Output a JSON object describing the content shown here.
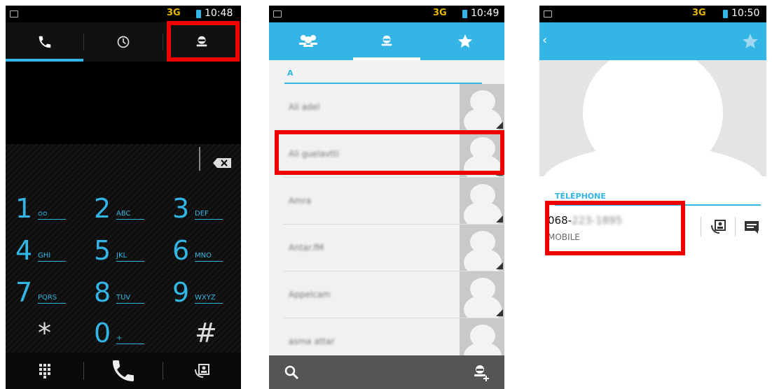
{
  "status_bars": [
    {
      "network": "3G",
      "time": "10:48"
    },
    {
      "network": "3G",
      "time": "10:49"
    },
    {
      "network": "3G",
      "time": "10:50"
    }
  ],
  "dialer": {
    "tabs": [
      "phone-icon",
      "clock-icon",
      "contact-icon"
    ],
    "selected_tab": 0,
    "keys": [
      {
        "digit": "1",
        "letters": "ᴑᴑ"
      },
      {
        "digit": "2",
        "letters": "ABC"
      },
      {
        "digit": "3",
        "letters": "DEF"
      },
      {
        "digit": "4",
        "letters": "GHI"
      },
      {
        "digit": "5",
        "letters": "JKL"
      },
      {
        "digit": "6",
        "letters": "MNO"
      },
      {
        "digit": "7",
        "letters": "PQRS"
      },
      {
        "digit": "8",
        "letters": "TUV"
      },
      {
        "digit": "9",
        "letters": "WXYZ"
      },
      {
        "digit": "*",
        "letters": ""
      },
      {
        "digit": "0",
        "letters": "+"
      },
      {
        "digit": "#",
        "letters": ""
      }
    ]
  },
  "contacts": {
    "tabs": [
      "groups-icon",
      "contact-icon",
      "star-icon"
    ],
    "selected_tab": 1,
    "section": "A",
    "items": [
      "Ali adel",
      "Ali guelavtti",
      "Amra",
      "Antar.fM",
      "Appelcam",
      "asma attar"
    ]
  },
  "detail": {
    "section": "TÉLÉPHONE",
    "phone_prefix": "068-",
    "phone_hidden": "223-1895",
    "phone_type": "MOBILE"
  },
  "colors": {
    "accent": "#33b5e5",
    "highlight": "#ee0000"
  }
}
